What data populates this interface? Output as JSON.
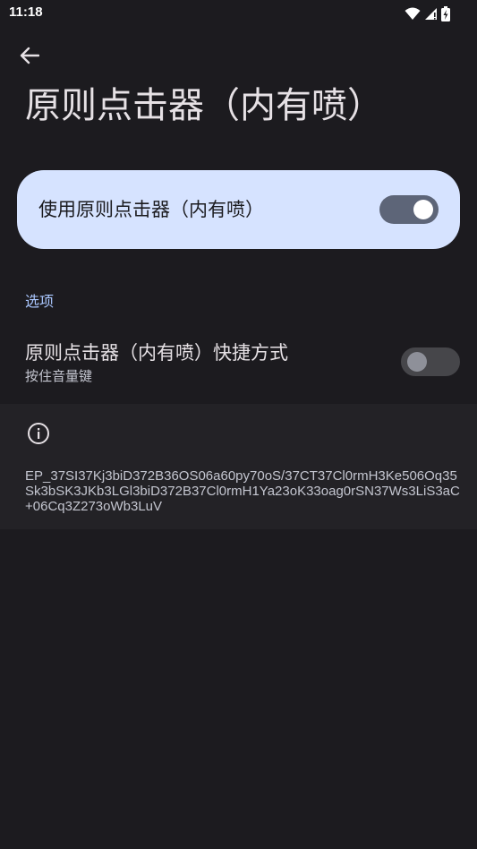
{
  "status_bar": {
    "time": "11:18",
    "icons": [
      "wifi-icon",
      "signal-icon",
      "battery-charging-icon"
    ]
  },
  "header": {
    "back_icon": "arrow-left-icon",
    "title": "原则点击器（内有喷）"
  },
  "main_toggle": {
    "label": "使用原则点击器（内有喷）",
    "checked": true
  },
  "options_section": {
    "header": "选项",
    "shortcut": {
      "title": "原则点击器（内有喷）快捷方式",
      "summary": "按住音量键",
      "checked": false
    }
  },
  "info": {
    "icon": "info-icon",
    "text": "EP_37SI37Kj3biD372B36OS06a60py70oS/37CT37Cl0rmH3Ke506Oq35Sk3bSK3JKb3LGl3biD372B37Cl0rmH1Ya23oK33oag0rSN37Ws3LiS3aC+06Cq3Z273oWb3LuV"
  },
  "colors": {
    "background": "#1c1b1f",
    "card": "#d6e3ff",
    "accent": "#aac7ff"
  }
}
